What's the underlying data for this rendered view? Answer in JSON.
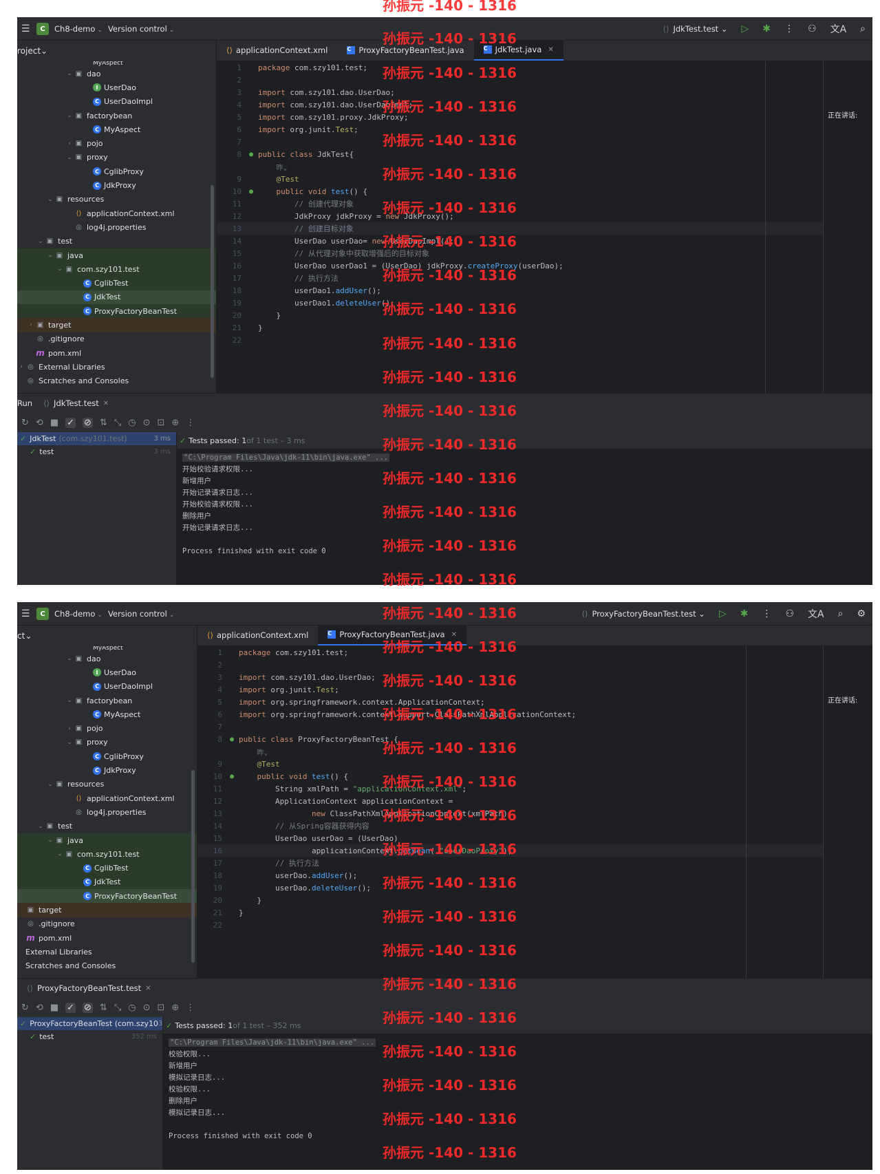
{
  "shot1": {
    "project_name": "Ch8-demo",
    "project_badge": "C",
    "version_control": "Version control",
    "run_config": "JdkTest.test",
    "sidebar_title": "roject",
    "tree": [
      {
        "indent": 7,
        "arrow": "",
        "icon": "",
        "label": "MyAspect",
        "style": "cut"
      },
      {
        "indent": 5,
        "arrow": "⌄",
        "icon": "fold",
        "label": "dao"
      },
      {
        "indent": 7,
        "arrow": "",
        "icon": "itf",
        "label": "UserDao"
      },
      {
        "indent": 7,
        "arrow": "",
        "icon": "cls",
        "label": "UserDaoImpl"
      },
      {
        "indent": 5,
        "arrow": "⌄",
        "icon": "fold",
        "label": "factorybean"
      },
      {
        "indent": 7,
        "arrow": "",
        "icon": "cls",
        "label": "MyAspect"
      },
      {
        "indent": 5,
        "arrow": "›",
        "icon": "fold",
        "label": "pojo"
      },
      {
        "indent": 5,
        "arrow": "⌄",
        "icon": "fold",
        "label": "proxy"
      },
      {
        "indent": 7,
        "arrow": "",
        "icon": "cls",
        "label": "CglibProxy"
      },
      {
        "indent": 7,
        "arrow": "",
        "icon": "cls",
        "label": "JdkProxy"
      },
      {
        "indent": 3,
        "arrow": "⌄",
        "icon": "fold",
        "label": "resources"
      },
      {
        "indent": 5,
        "arrow": "",
        "icon": "xml",
        "label": "applicationContext.xml"
      },
      {
        "indent": 5,
        "arrow": "",
        "icon": "misc",
        "label": "log4j.properties"
      },
      {
        "indent": 2,
        "arrow": "⌄",
        "icon": "fold",
        "label": "test"
      },
      {
        "indent": 3,
        "arrow": "⌄",
        "icon": "fold",
        "label": "java",
        "style": "green"
      },
      {
        "indent": 4,
        "arrow": "⌄",
        "icon": "fold",
        "label": "com.szy101.test",
        "style": "green"
      },
      {
        "indent": 6,
        "arrow": "",
        "icon": "cls",
        "label": "CglibTest",
        "style": "green"
      },
      {
        "indent": 6,
        "arrow": "",
        "icon": "cls",
        "label": "JdkTest",
        "style": "sel"
      },
      {
        "indent": 6,
        "arrow": "",
        "icon": "cls",
        "label": "ProxyFactoryBeanTest",
        "style": "green"
      },
      {
        "indent": 1,
        "arrow": "›",
        "icon": "fold",
        "label": "target",
        "style": "orange"
      },
      {
        "indent": 1,
        "arrow": "",
        "icon": "misc",
        "label": ".gitignore"
      },
      {
        "indent": 1,
        "arrow": "",
        "icon": "mvn",
        "label": "pom.xml"
      },
      {
        "indent": 0,
        "arrow": "›",
        "icon": "misc",
        "label": "External Libraries"
      },
      {
        "indent": 0,
        "arrow": "",
        "icon": "misc",
        "label": "Scratches and Consoles"
      }
    ],
    "tabs": [
      {
        "icon": "xml",
        "label": "applicationContext.xml",
        "active": false
      },
      {
        "icon": "cls",
        "label": "ProxyFactoryBeanTest.java",
        "active": false
      },
      {
        "icon": "cls",
        "label": "JdkTest.java",
        "active": true
      }
    ],
    "code": [
      {
        "ln": "1",
        "html": "<span class=\"k\">package</span> com.szy101.test;"
      },
      {
        "ln": "2",
        "html": ""
      },
      {
        "ln": "3",
        "html": "<span class=\"k\">import</span> com.szy101.dao.UserDao;"
      },
      {
        "ln": "4",
        "html": "<span class=\"k\">import</span> com.szy101.dao.UserDaoImpl;"
      },
      {
        "ln": "5",
        "html": "<span class=\"k\">import</span> com.szy101.proxy.JdkProxy;"
      },
      {
        "ln": "6",
        "html": "<span class=\"k\">import</span> org.junit.<span class=\"ann\">Test</span>;"
      },
      {
        "ln": "7",
        "html": ""
      },
      {
        "ln": "8",
        "gut": "●",
        "html": "<span class=\"k\">public class</span> JdkTest{"
      },
      {
        "ln": "",
        "html": "    <span class=\"hint\">昨⌄</span>"
      },
      {
        "ln": "9",
        "html": "    <span class=\"ann\">@Test</span>"
      },
      {
        "ln": "10",
        "gut": "●",
        "html": "    <span class=\"k\">public void</span> <span class=\"fn\">test</span>() {"
      },
      {
        "ln": "11",
        "html": "        <span class=\"cmt\">// 创建代理对象</span>"
      },
      {
        "ln": "12",
        "html": "        JdkProxy jdkProxy = <span class=\"k\">new</span> JdkProxy();"
      },
      {
        "ln": "13",
        "hl": true,
        "html": "        <span class=\"cmt\">// 创建目标对象</span>"
      },
      {
        "ln": "14",
        "html": "        UserDao userDao= <span class=\"k\">new</span> UserDaoImpl();"
      },
      {
        "ln": "15",
        "html": "        <span class=\"cmt\">// 从代理对象中获取增强后的目标对象</span>"
      },
      {
        "ln": "16",
        "html": "        UserDao userDao1 = (UserDao) jdkProxy.<span class=\"fn\">createProxy</span>(userDao);"
      },
      {
        "ln": "17",
        "html": "        <span class=\"cmt\">// 执行方法</span>"
      },
      {
        "ln": "18",
        "html": "        userDao1.<span class=\"fn\">addUser</span>();"
      },
      {
        "ln": "19",
        "html": "        userDao1.<span class=\"fn\">deleteUser</span>();"
      },
      {
        "ln": "20",
        "html": "    }"
      },
      {
        "ln": "21",
        "html": "}"
      },
      {
        "ln": "22",
        "html": ""
      }
    ],
    "speaking": "正在讲话:",
    "run_label": "Run",
    "run_tab": "JdkTest.test",
    "run_tree": [
      {
        "label": "JdkTest",
        "dim": "(com.szy101.test)",
        "ms": "3 ms",
        "sel": true
      },
      {
        "label": "test",
        "dim": "",
        "ms": "3 ms",
        "sel": false
      }
    ],
    "status_passed": "Tests passed: 1",
    "status_rest": " of 1 test – 3 ms",
    "console_cmd": "\"C:\\Program Files\\Java\\jdk-11\\bin\\java.exe\" ...",
    "console_lines": [
      "开始校验请求权限...",
      "新增用户",
      "开始记录请求日志...",
      "开始校验请求权限...",
      "删除用户",
      "开始记录请求日志...",
      "",
      "Process finished with exit code 0"
    ]
  },
  "shot2": {
    "project_name": "Ch8-demo",
    "project_badge": "C",
    "version_control": "Version control",
    "run_config": "ProxyFactoryBeanTest.test",
    "sidebar_title": "ct",
    "tree": [
      {
        "indent": 7,
        "arrow": "",
        "icon": "",
        "label": "MyAspect",
        "style": "cut"
      },
      {
        "indent": 5,
        "arrow": "⌄",
        "icon": "fold",
        "label": "dao"
      },
      {
        "indent": 7,
        "arrow": "",
        "icon": "itf",
        "label": "UserDao"
      },
      {
        "indent": 7,
        "arrow": "",
        "icon": "cls",
        "label": "UserDaoImpl"
      },
      {
        "indent": 5,
        "arrow": "⌄",
        "icon": "fold",
        "label": "factorybean"
      },
      {
        "indent": 7,
        "arrow": "",
        "icon": "cls",
        "label": "MyAspect"
      },
      {
        "indent": 5,
        "arrow": "›",
        "icon": "fold",
        "label": "pojo"
      },
      {
        "indent": 5,
        "arrow": "⌄",
        "icon": "fold",
        "label": "proxy"
      },
      {
        "indent": 7,
        "arrow": "",
        "icon": "cls",
        "label": "CglibProxy"
      },
      {
        "indent": 7,
        "arrow": "",
        "icon": "cls",
        "label": "JdkProxy"
      },
      {
        "indent": 3,
        "arrow": "⌄",
        "icon": "fold",
        "label": "resources"
      },
      {
        "indent": 5,
        "arrow": "",
        "icon": "xml",
        "label": "applicationContext.xml"
      },
      {
        "indent": 5,
        "arrow": "",
        "icon": "misc",
        "label": "log4j.properties"
      },
      {
        "indent": 2,
        "arrow": "⌄",
        "icon": "fold",
        "label": "test"
      },
      {
        "indent": 3,
        "arrow": "⌄",
        "icon": "fold",
        "label": "java",
        "style": "green"
      },
      {
        "indent": 4,
        "arrow": "⌄",
        "icon": "fold",
        "label": "com.szy101.test",
        "style": "green"
      },
      {
        "indent": 6,
        "arrow": "",
        "icon": "cls",
        "label": "CglibTest",
        "style": "green"
      },
      {
        "indent": 6,
        "arrow": "",
        "icon": "cls",
        "label": "JdkTest",
        "style": "green"
      },
      {
        "indent": 6,
        "arrow": "",
        "icon": "cls",
        "label": "ProxyFactoryBeanTest",
        "style": "sel"
      },
      {
        "indent": 0,
        "arrow": "",
        "icon": "fold",
        "label": "target",
        "style": "orange"
      },
      {
        "indent": 0,
        "arrow": "",
        "icon": "misc",
        "label": ".gitignore"
      },
      {
        "indent": 0,
        "arrow": "",
        "icon": "mvn",
        "label": "pom.xml"
      },
      {
        "indent": 0,
        "arrow": "",
        "icon": "",
        "label": "External Libraries"
      },
      {
        "indent": 0,
        "arrow": "",
        "icon": "",
        "label": "Scratches and Consoles"
      }
    ],
    "tabs": [
      {
        "icon": "xml",
        "label": "applicationContext.xml",
        "active": false
      },
      {
        "icon": "cls",
        "label": "ProxyFactoryBeanTest.java",
        "active": true
      }
    ],
    "code": [
      {
        "ln": "1",
        "html": "<span class=\"k\">package</span> com.szy101.test;"
      },
      {
        "ln": "2",
        "html": ""
      },
      {
        "ln": "3",
        "html": "<span class=\"k\">import</span> com.szy101.dao.UserDao;"
      },
      {
        "ln": "4",
        "html": "<span class=\"k\">import</span> org.junit.<span class=\"ann\">Test</span>;"
      },
      {
        "ln": "5",
        "html": "<span class=\"k\">import</span> org.springframework.context.ApplicationContext;"
      },
      {
        "ln": "6",
        "html": "<span class=\"k\">import</span> org.springframework.context.support.ClassPathXmlApplicationContext;"
      },
      {
        "ln": "7",
        "html": ""
      },
      {
        "ln": "8",
        "gut": "●",
        "html": "<span class=\"k\">public class</span> ProxyFactoryBeanTest {"
      },
      {
        "ln": "",
        "html": "    <span class=\"hint\">昨⌄</span>"
      },
      {
        "ln": "9",
        "html": "    <span class=\"ann\">@Test</span>"
      },
      {
        "ln": "10",
        "gut": "●",
        "html": "    <span class=\"k\">public void</span> <span class=\"fn\">test</span>() {"
      },
      {
        "ln": "11",
        "html": "        String xmlPath = <span class=\"str\">\"applicationContext.xml\"</span>;"
      },
      {
        "ln": "12",
        "html": "        ApplicationContext applicationContext ="
      },
      {
        "ln": "13",
        "html": "                <span class=\"k\">new</span> ClassPathXmlApplicationContext(xmlPath);"
      },
      {
        "ln": "14",
        "html": "        <span class=\"cmt\">// 从Spring容器获得内容</span>"
      },
      {
        "ln": "15",
        "html": "        UserDao userDao = (UserDao)"
      },
      {
        "ln": "16",
        "hl": true,
        "html": "                applicationContext.<span class=\"fn\">getBean</span>( <span class=\"str\">\"userDaoProxy\"</span>);"
      },
      {
        "ln": "17",
        "html": "        <span class=\"cmt\">// 执行方法</span>"
      },
      {
        "ln": "18",
        "html": "        userDao.<span class=\"fn\">addUser</span>();"
      },
      {
        "ln": "19",
        "html": "        userDao.<span class=\"fn\">deleteUser</span>();"
      },
      {
        "ln": "20",
        "html": "    }"
      },
      {
        "ln": "21",
        "html": "}"
      },
      {
        "ln": "22",
        "html": ""
      }
    ],
    "speaking": "正在讲话:",
    "run_label": "",
    "run_tab": "ProxyFactoryBeanTest.test",
    "run_tree": [
      {
        "label": "ProxyFactoryBeanTest (com.szy10",
        "dim": "",
        "ms": "352 ms",
        "sel": true
      },
      {
        "label": "test",
        "dim": "",
        "ms": "352 ms",
        "sel": false
      }
    ],
    "status_passed": "Tests passed: 1",
    "status_rest": " of 1 test – 352 ms",
    "console_cmd": "\"C:\\Program Files\\Java\\jdk-11\\bin\\java.exe\" ...",
    "console_lines": [
      "校验权限...",
      "新增用户",
      "模拟记录日志...",
      "校验权限...",
      "删除用户",
      "模拟记录日志...",
      "",
      "Process finished with exit code 0"
    ]
  },
  "watermark": "孙振元 -140 - 1316",
  "colors": {
    "ide_bg": "#1e1f22",
    "panel_bg": "#2b2d30",
    "accent": "#3574f0",
    "watermark": "#ff2a2a"
  }
}
